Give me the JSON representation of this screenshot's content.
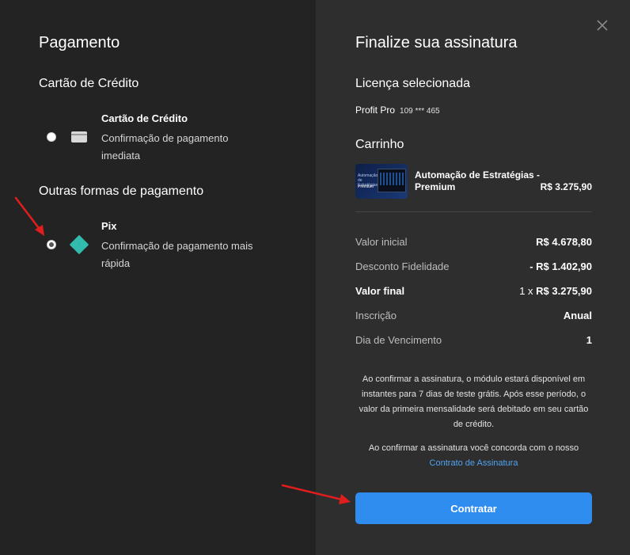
{
  "left": {
    "title": "Pagamento",
    "credit_section": "Cartão de Crédito",
    "credit_option": {
      "title": "Cartão de Crédito",
      "description": "Confirmação de pagamento imediata",
      "icon": "credit-card-icon",
      "selected": false
    },
    "other_section": "Outras formas de pagamento",
    "pix_option": {
      "title": "Pix",
      "description": "Confirmação de pagamento mais rápida",
      "icon": "pix-icon",
      "icon_color": "#32bcad",
      "selected": true
    }
  },
  "right": {
    "title": "Finalize sua assinatura",
    "close_icon": "close-icon",
    "license_heading": "Licença selecionada",
    "license_name": "Profit Pro",
    "license_number": "109 *** 465",
    "cart_heading": "Carrinho",
    "cart_item": {
      "thumb_line1": "Automação de Estratégias",
      "thumb_line2": "Premium",
      "name": "Automação de Estratégias - Premium",
      "price": "R$ 3.275,90"
    },
    "summary": [
      {
        "label": "Valor inicial",
        "value": "R$ 4.678,80"
      },
      {
        "label": "Desconto Fidelidade",
        "value": "- R$ 1.402,90"
      },
      {
        "label": "Valor final",
        "value_prefix": "1 x ",
        "value": "R$ 3.275,90"
      },
      {
        "label": "Inscrição",
        "value": "Anual"
      },
      {
        "label": "Dia de Vencimento",
        "value": "1"
      }
    ],
    "note1": "Ao confirmar a assinatura, o módulo estará disponível em instantes para 7 dias de teste grátis. Após esse período, o valor da primeira mensalidade será debitado em seu cartão de crédito.",
    "note2": "Ao confirmar a assinatura você concorda com o nosso",
    "contract_link": "Contrato de Assinatura",
    "submit_label": "Contratar"
  },
  "colors": {
    "left_bg": "#232323",
    "right_bg": "#2e2e2e",
    "accent": "#2f8df0",
    "link": "#4fa3f0",
    "annotation_arrow": "#e01e1e"
  }
}
